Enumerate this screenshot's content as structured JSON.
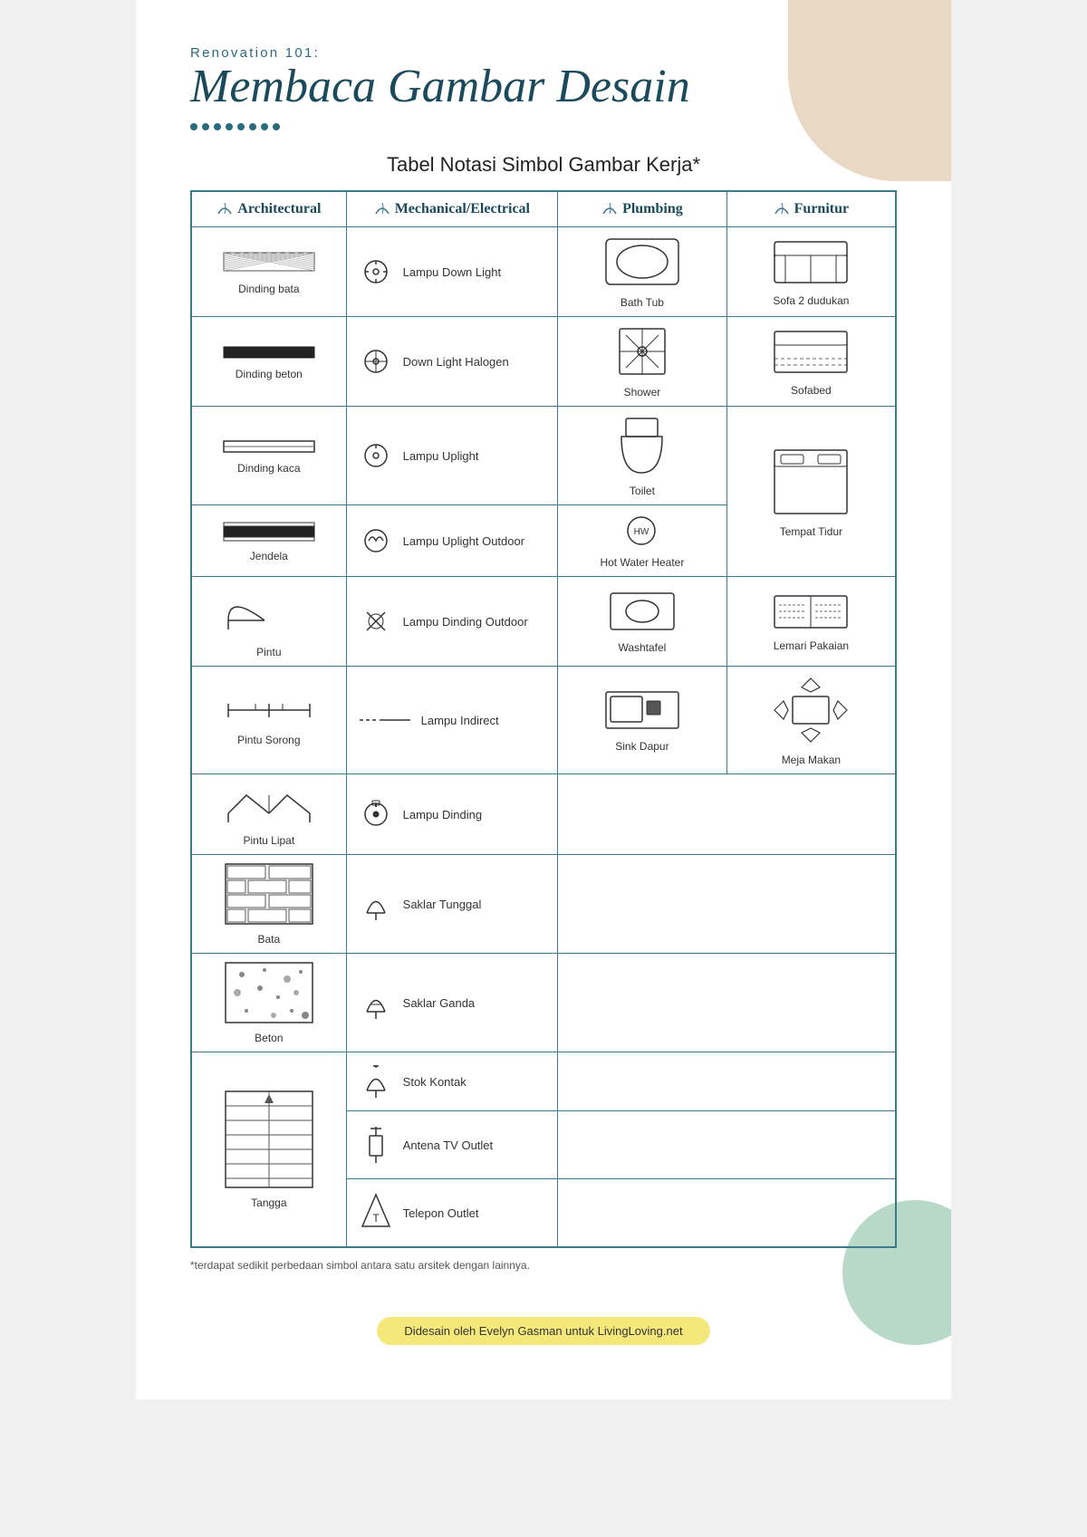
{
  "header": {
    "renovation_label": "Renovation 101:",
    "title": "Membaca Gambar Desain",
    "table_title": "Tabel Notasi Simbol Gambar Kerja*"
  },
  "columns": {
    "arch": "Architectural",
    "mech": "Mechanical/Electrical",
    "plumb": "Plumbing",
    "furn": "Furnitur"
  },
  "arch_items": [
    "Dinding bata",
    "Dinding beton",
    "Dinding kaca",
    "Jendela",
    "Pintu",
    "Pintu Sorong",
    "Pintu Lipat",
    "Bata",
    "Beton",
    "Tangga"
  ],
  "mech_items": [
    "Lampu Down Light",
    "Down Light Halogen",
    "Lampu Uplight",
    "Lampu Uplight Outdoor",
    "Lampu Dinding Outdoor",
    "Lampu Indirect",
    "Lampu Dinding",
    "Saklar Tunggal",
    "Saklar Ganda",
    "Stok Kontak",
    "Antena TV Outlet",
    "Telepon Outlet"
  ],
  "plumb_items": [
    "Bath Tub",
    "Shower",
    "Toilet",
    "Hot Water Heater",
    "Washtafel",
    "Sink Dapur"
  ],
  "furn_items": [
    "Sofa 2 dudukan",
    "Sofabed",
    "Tempat Tidur",
    "Lemari Pakaian",
    "Meja Makan"
  ],
  "footnote": "*terdapat sedikit perbedaan simbol antara satu arsitek dengan lainnya.",
  "footer": "Didesain oleh Evelyn Gasman untuk LivingLoving.net"
}
